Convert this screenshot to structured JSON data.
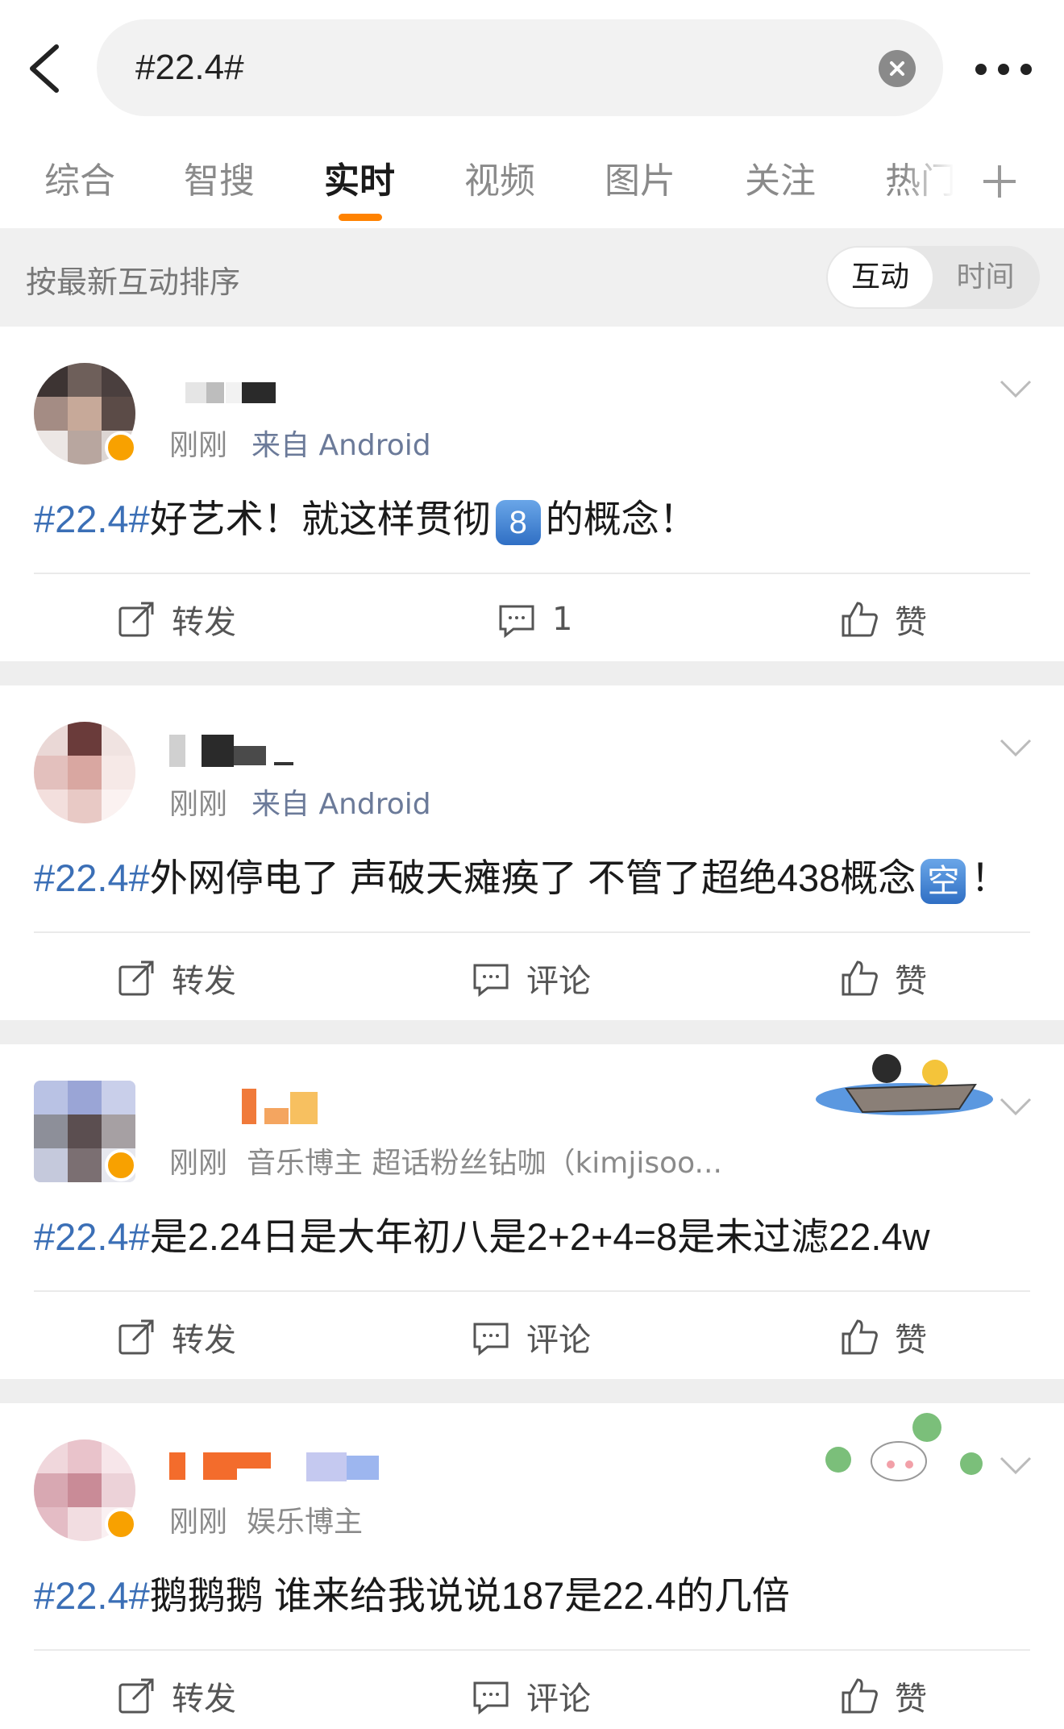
{
  "header": {
    "search_value": "#22.4#",
    "icons": [
      "back-icon",
      "clear-icon",
      "more-icon"
    ]
  },
  "tabs": [
    {
      "label": "综合"
    },
    {
      "label": "智搜"
    },
    {
      "label": "实时"
    },
    {
      "label": "视频"
    },
    {
      "label": "图片"
    },
    {
      "label": "关注"
    },
    {
      "label": "热门"
    }
  ],
  "sort": {
    "label": "按最新互动排序",
    "options": [
      "互动",
      "时间"
    ],
    "selected": "互动"
  },
  "actions_labels": {
    "repost": "转发",
    "comment": "评论",
    "like": "赞"
  },
  "posts": [
    {
      "time": "刚刚",
      "source": "来自 Android",
      "topic": "#22.4#",
      "text_a": "好艺术！就这样贯彻",
      "emoji": "8",
      "text_b": "的概念！",
      "comment_count": "1"
    },
    {
      "time": "刚刚",
      "source": "来自 Android",
      "topic": "#22.4#",
      "text_a": "外网停电了 声破天瘫痪了 不管了超绝438概念",
      "emoji": "空",
      "text_b": "！"
    },
    {
      "time": "刚刚",
      "tags": "音乐博主 超话粉丝钻咖（kimjisoo...",
      "topic": "#22.4#",
      "text_a": "是2.24日是大年初八是2+2+4=8是未过滤22.4w"
    },
    {
      "time": "刚刚",
      "tags": "娱乐博主",
      "topic": "#22.4#",
      "text_a": "鹅鹅鹅 谁来给我说说187是22.4的几倍"
    }
  ],
  "colors": {
    "accent": "#ff8200",
    "topic": "#3b6fb6",
    "verified": "#f8a100"
  }
}
